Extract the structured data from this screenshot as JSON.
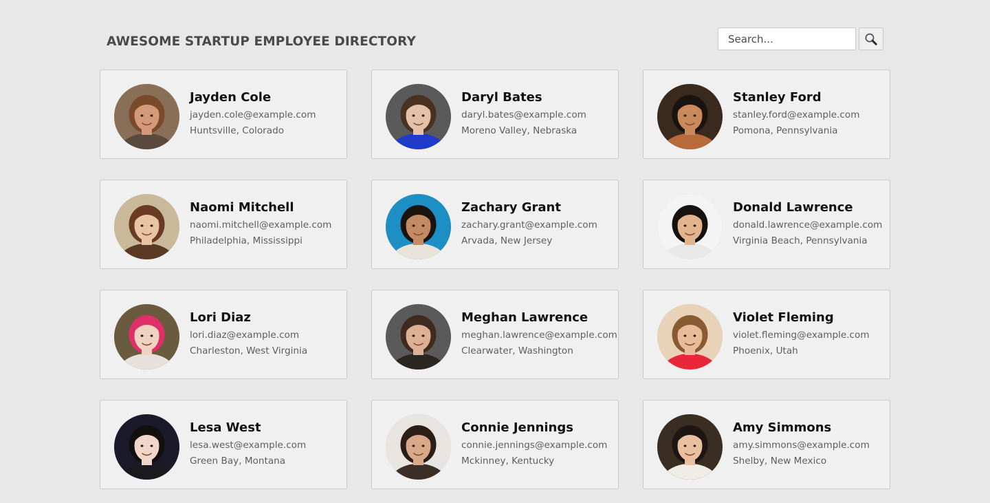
{
  "header": {
    "title": "AWESOME STARTUP EMPLOYEE DIRECTORY"
  },
  "search": {
    "placeholder": "Search...",
    "button_icon": "search-icon"
  },
  "colors": {
    "background": "#e8e8e8",
    "card_background": "#f0f0f0",
    "card_border": "#c9c9c9",
    "name_text": "#111111",
    "detail_text": "#5e5e5e"
  },
  "employees": [
    {
      "name": "Jayden Cole",
      "email": "jayden.cole@example.com",
      "location": "Huntsville, Colorado",
      "bg": "#8a6f58",
      "skin": "#d29a78",
      "hair": "#7a4a2a",
      "shirt": "#5a4a3e"
    },
    {
      "name": "Daryl Bates",
      "email": "daryl.bates@example.com",
      "location": "Moreno Valley, Nebraska",
      "bg": "#5a5a5a",
      "skin": "#e3c0a8",
      "hair": "#4a3222",
      "shirt": "#1f39c9"
    },
    {
      "name": "Stanley Ford",
      "email": "stanley.ford@example.com",
      "location": "Pomona, Pennsylvania",
      "bg": "#3a2a1e",
      "skin": "#c88a5a",
      "hair": "#1a1410",
      "shirt": "#b86a3a"
    },
    {
      "name": "Naomi Mitchell",
      "email": "naomi.mitchell@example.com",
      "location": "Philadelphia, Mississippi",
      "bg": "#c9b89a",
      "skin": "#e8c4a2",
      "hair": "#6a3a22",
      "shirt": "#5a3a24"
    },
    {
      "name": "Zachary Grant",
      "email": "zachary.grant@example.com",
      "location": "Arvada, New Jersey",
      "bg": "#1e8fc4",
      "skin": "#c48a62",
      "hair": "#1a1410",
      "shirt": "#e8e4da"
    },
    {
      "name": "Donald Lawrence",
      "email": "donald.lawrence@example.com",
      "location": "Virginia Beach, Pennsylvania",
      "bg": "#f4f4f4",
      "skin": "#e2b48e",
      "hair": "#161210",
      "shirt": "#e8e8e8"
    },
    {
      "name": "Lori Diaz",
      "email": "lori.diaz@example.com",
      "location": "Charleston, West Virginia",
      "bg": "#6a5a3e",
      "skin": "#f0d2c0",
      "hair": "#e0306a",
      "shirt": "#e8e0dc"
    },
    {
      "name": "Meghan Lawrence",
      "email": "meghan.lawrence@example.com",
      "location": "Clearwater, Washington",
      "bg": "#5a5a5a",
      "skin": "#dcb094",
      "hair": "#3e2a1e",
      "shirt": "#2a2622"
    },
    {
      "name": "Violet Fleming",
      "email": "violet.fleming@example.com",
      "location": "Phoenix, Utah",
      "bg": "#e8d2b8",
      "skin": "#e8bc98",
      "hair": "#8a5a32",
      "shirt": "#e8283a"
    },
    {
      "name": "Lesa West",
      "email": "lesa.west@example.com",
      "location": "Green Bay, Montana",
      "bg": "#1a1a2a",
      "skin": "#f0d6c8",
      "hair": "#12100e",
      "shirt": "#1a1a1e"
    },
    {
      "name": "Connie Jennings",
      "email": "connie.jennings@example.com",
      "location": "Mckinney, Kentucky",
      "bg": "#e8e4e0",
      "skin": "#d8a888",
      "hair": "#2a1e16",
      "shirt": "#3a2e26"
    },
    {
      "name": "Amy Simmons",
      "email": "amy.simmons@example.com",
      "location": "Shelby, New Mexico",
      "bg": "#3a2e22",
      "skin": "#e8c0a0",
      "hair": "#1e1612",
      "shirt": "#f0ece8"
    }
  ]
}
